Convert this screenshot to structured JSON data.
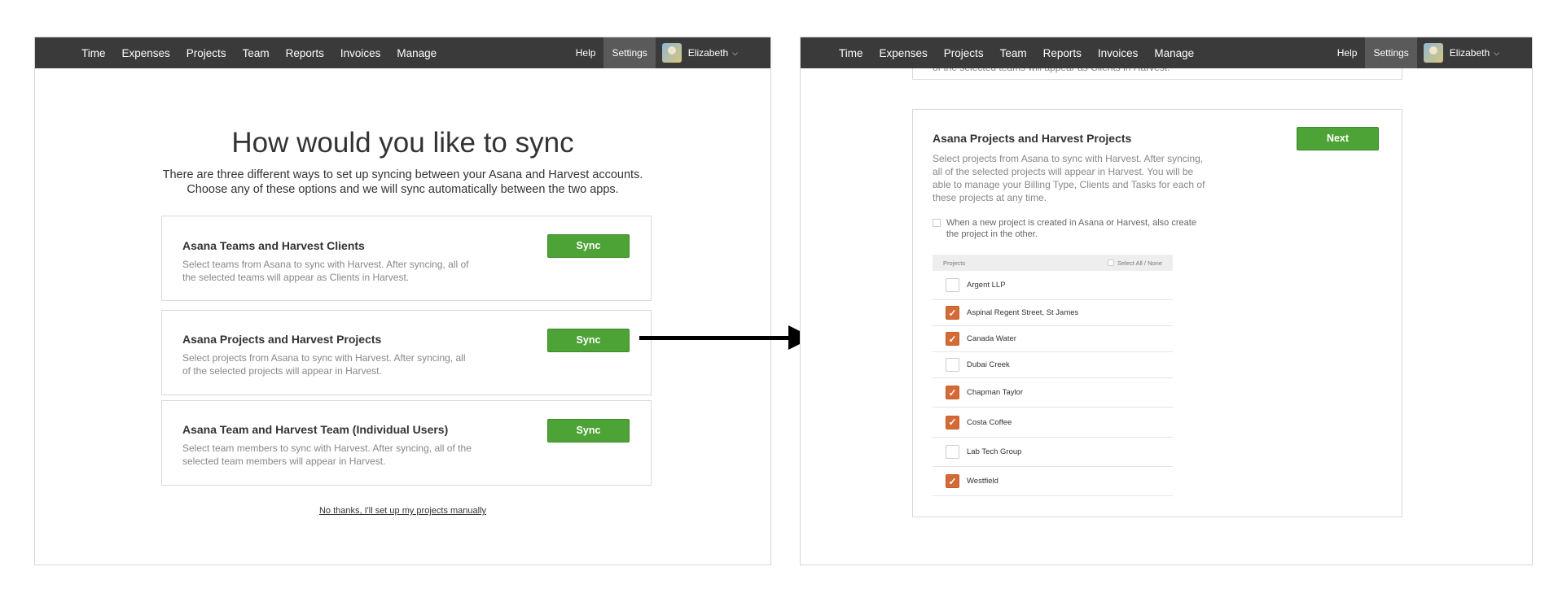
{
  "nav": {
    "items": [
      "Time",
      "Expenses",
      "Projects",
      "Team",
      "Reports",
      "Invoices",
      "Manage"
    ],
    "help": "Help",
    "settings": "Settings",
    "user": "Elizabeth"
  },
  "left": {
    "title": "How would you like to sync",
    "desc_line1": "There are three different ways to set up syncing between your Asana and Harvest accounts.",
    "desc_line2": "Choose any of these options and we will sync automatically between the two apps.",
    "cards": [
      {
        "title": "Asana Teams and Harvest Clients",
        "desc": "Select teams from Asana to sync with Harvest. After syncing, all of the selected teams will appear as Clients in Harvest.",
        "button": "Sync"
      },
      {
        "title": "Asana Projects and Harvest Projects",
        "desc": "Select projects from Asana to sync with Harvest. After syncing, all of the selected projects will appear in Harvest.",
        "button": "Sync"
      },
      {
        "title": "Asana Team and Harvest Team (Individual Users)",
        "desc": "Select team members to sync with Harvest. After syncing, all of the selected team members will appear in Harvest.",
        "button": "Sync"
      }
    ],
    "manual_link": "No thanks, I'll set up my projects manually"
  },
  "right": {
    "top_card_text": "of the selected teams will appear as Clients in Harvest.",
    "title": "Asana Projects and Harvest Projects",
    "next_button": "Next",
    "desc": "Select projects from Asana to sync with Harvest. After syncing, all of the selected projects will appear in Harvest. You will be able to manage your Billing Type, Clients and Tasks for each of these projects at any time.",
    "auto_create": "When a new project is created in Asana or Harvest, also create the project in the other.",
    "list_header": "Projects",
    "select_all": "Select All / None",
    "projects": [
      {
        "name": "Argent LLP",
        "checked": false
      },
      {
        "name": "Aspinal Regent Street, St James",
        "checked": true
      },
      {
        "name": "Canada Water",
        "checked": true
      },
      {
        "name": "Dubai Creek",
        "checked": false
      },
      {
        "name": "Chapman Taylor",
        "checked": true
      },
      {
        "name": "Costa Coffee",
        "checked": true
      },
      {
        "name": "Lab Tech Group",
        "checked": false
      },
      {
        "name": "Westfield",
        "checked": true
      }
    ]
  },
  "colors": {
    "nav_bg": "#3a3a3a",
    "button_green": "#4da336",
    "checkbox_orange": "#d46a35"
  }
}
